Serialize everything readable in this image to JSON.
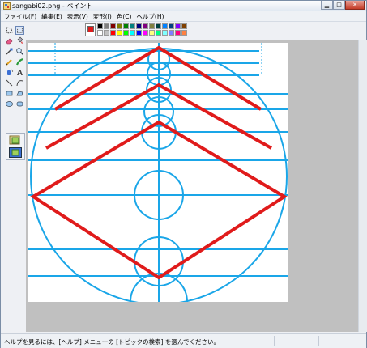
{
  "window": {
    "title": "sangabi02.png - ペイント"
  },
  "menu": {
    "items": [
      {
        "label": "ファイル(F)"
      },
      {
        "label": "編集(E)"
      },
      {
        "label": "表示(V)"
      },
      {
        "label": "変形(I)"
      },
      {
        "label": "色(C)"
      },
      {
        "label": "ヘルプ(H)"
      }
    ]
  },
  "tools": [
    "free-select",
    "rect-select",
    "eraser",
    "fill",
    "color-picker",
    "magnifier",
    "pencil",
    "brush",
    "airbrush",
    "text",
    "line",
    "curve",
    "rectangle",
    "polygon",
    "ellipse",
    "rounded-rectangle"
  ],
  "palette": {
    "foreground": "#e01b1b",
    "background": "#ffffff",
    "row1": [
      "#000000",
      "#808080",
      "#800000",
      "#808000",
      "#008000",
      "#008080",
      "#000080",
      "#800080",
      "#808040",
      "#004040",
      "#0080ff",
      "#004080",
      "#8000ff",
      "#804000"
    ],
    "row2": [
      "#ffffff",
      "#c0c0c0",
      "#ff0000",
      "#ffff00",
      "#00ff00",
      "#00ffff",
      "#0000ff",
      "#ff00ff",
      "#ffff80",
      "#00ff80",
      "#80ffff",
      "#8080ff",
      "#ff0080",
      "#ff8040"
    ]
  },
  "drawing": {
    "line_color": "#1aa6e8",
    "accent_color": "#e01b1b"
  },
  "status": {
    "text": "ヘルプを見るには、[ヘルプ] メニューの [トピックの検索] を選んでください。"
  }
}
